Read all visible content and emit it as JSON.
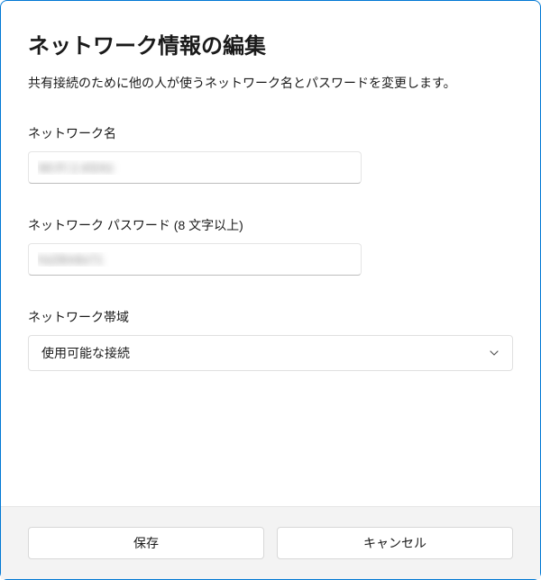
{
  "dialog": {
    "title": "ネットワーク情報の編集",
    "description": "共有接続のために他の人が使うネットワーク名とパスワードを変更します。"
  },
  "fields": {
    "network_name": {
      "label": "ネットワーク名",
      "value": "Wi-Fi 2.4GHz"
    },
    "network_password": {
      "label": "ネットワーク パスワード (8 文字以上)",
      "value": "hs28m6x71"
    },
    "network_band": {
      "label": "ネットワーク帯域",
      "selected": "使用可能な接続"
    }
  },
  "buttons": {
    "save": "保存",
    "cancel": "キャンセル"
  }
}
